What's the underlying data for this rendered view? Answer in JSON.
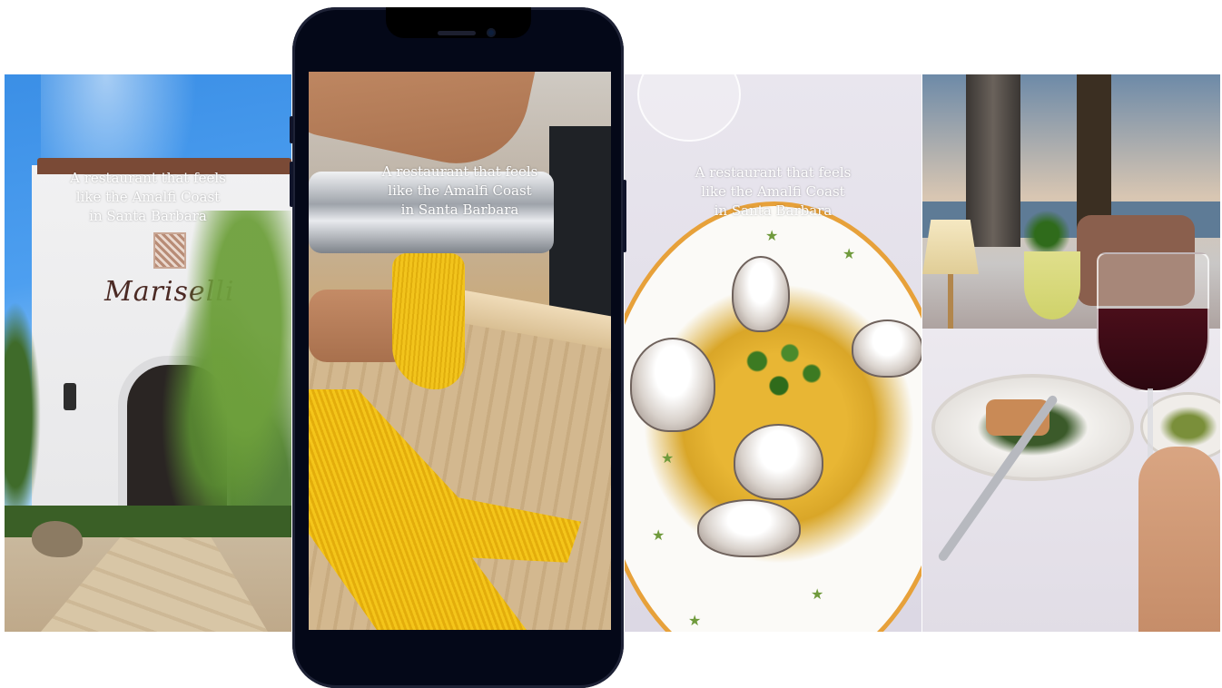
{
  "caption": {
    "line1": "A restaurant that feels",
    "line2": "like the Amalfi Coast",
    "line3": "in Santa Barbara"
  },
  "panels": [
    {
      "id": "exterior",
      "sign_text": "Mariselli"
    },
    {
      "id": "pasta-making"
    },
    {
      "id": "clams-pasta"
    },
    {
      "id": "dinner-table"
    }
  ],
  "colors": {
    "background": "#ffffff",
    "phone_frame": "#040818",
    "caption_text": "#ffffff",
    "plate_rim": "#e7a13a"
  },
  "icons": [
    "star-icon"
  ]
}
